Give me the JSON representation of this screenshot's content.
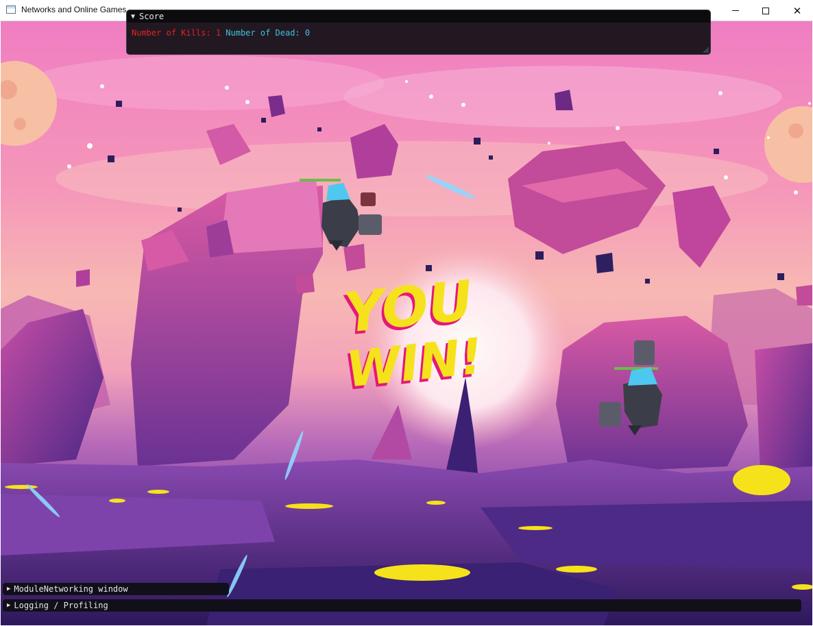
{
  "window": {
    "title": "Networks and Online Games",
    "minimize_glyph": "",
    "maximize_glyph": "",
    "close_glyph": "✕"
  },
  "score_panel": {
    "header": "Score",
    "collapse_glyph": "▼",
    "kills_text": "Number of Kills: 1",
    "dead_text": "Number of Dead: 0"
  },
  "game": {
    "banner_line1": "YOU",
    "banner_line2": "WIN!",
    "players": [
      {
        "health": 1.0
      },
      {
        "health": 1.0
      }
    ]
  },
  "bottom_bars": [
    {
      "label": "ModuleNetworking window",
      "glyph": "▶"
    },
    {
      "label": "Logging / Profiling",
      "glyph": "▶"
    }
  ],
  "colors": {
    "kills": "#e02424",
    "dead": "#3ec2e0",
    "health_bar": "#6dbd45",
    "banner_fill": "#f5e21c",
    "banner_shadow": "#e4187a"
  }
}
